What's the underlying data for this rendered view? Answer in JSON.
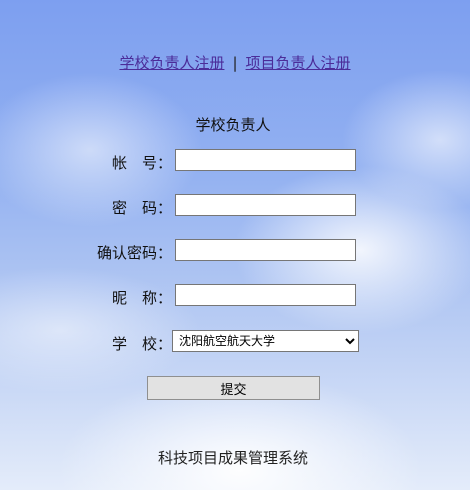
{
  "nav": {
    "school_register": "学校负责人注册",
    "separator": "|",
    "project_register": "项目负责人注册"
  },
  "form": {
    "title": "学校负责人",
    "account_label": "帐　号：",
    "password_label": "密　码：",
    "confirm_password_label": "确认密码：",
    "nickname_label": "昵　称：",
    "school_label": "学　校：",
    "school_selected": "沈阳航空航天大学",
    "submit_label": "提交"
  },
  "footer": {
    "text": "科技项目成果管理系统"
  }
}
